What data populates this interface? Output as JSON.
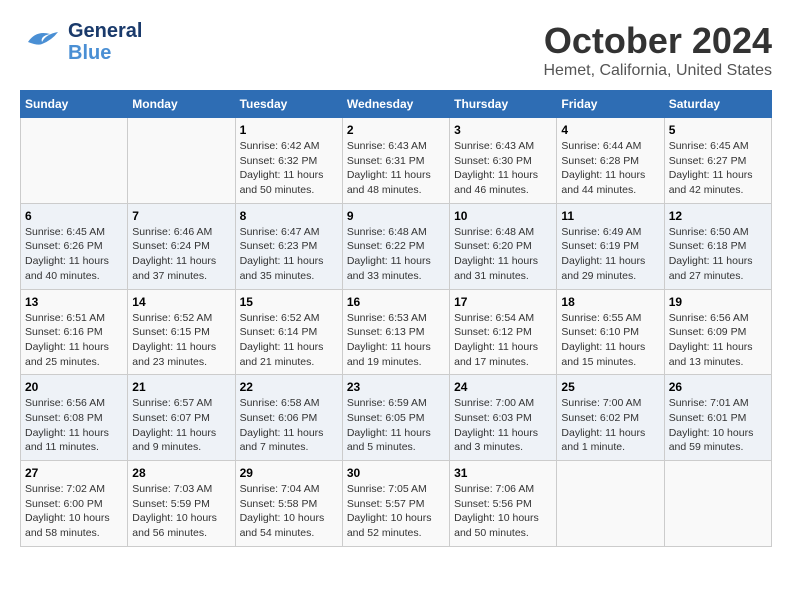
{
  "header": {
    "logo_general": "General",
    "logo_blue": "Blue",
    "month": "October 2024",
    "location": "Hemet, California, United States"
  },
  "days_of_week": [
    "Sunday",
    "Monday",
    "Tuesday",
    "Wednesday",
    "Thursday",
    "Friday",
    "Saturday"
  ],
  "weeks": [
    [
      {
        "day": "",
        "info": ""
      },
      {
        "day": "",
        "info": ""
      },
      {
        "day": "1",
        "info": "Sunrise: 6:42 AM\nSunset: 6:32 PM\nDaylight: 11 hours and 50 minutes."
      },
      {
        "day": "2",
        "info": "Sunrise: 6:43 AM\nSunset: 6:31 PM\nDaylight: 11 hours and 48 minutes."
      },
      {
        "day": "3",
        "info": "Sunrise: 6:43 AM\nSunset: 6:30 PM\nDaylight: 11 hours and 46 minutes."
      },
      {
        "day": "4",
        "info": "Sunrise: 6:44 AM\nSunset: 6:28 PM\nDaylight: 11 hours and 44 minutes."
      },
      {
        "day": "5",
        "info": "Sunrise: 6:45 AM\nSunset: 6:27 PM\nDaylight: 11 hours and 42 minutes."
      }
    ],
    [
      {
        "day": "6",
        "info": "Sunrise: 6:45 AM\nSunset: 6:26 PM\nDaylight: 11 hours and 40 minutes."
      },
      {
        "day": "7",
        "info": "Sunrise: 6:46 AM\nSunset: 6:24 PM\nDaylight: 11 hours and 37 minutes."
      },
      {
        "day": "8",
        "info": "Sunrise: 6:47 AM\nSunset: 6:23 PM\nDaylight: 11 hours and 35 minutes."
      },
      {
        "day": "9",
        "info": "Sunrise: 6:48 AM\nSunset: 6:22 PM\nDaylight: 11 hours and 33 minutes."
      },
      {
        "day": "10",
        "info": "Sunrise: 6:48 AM\nSunset: 6:20 PM\nDaylight: 11 hours and 31 minutes."
      },
      {
        "day": "11",
        "info": "Sunrise: 6:49 AM\nSunset: 6:19 PM\nDaylight: 11 hours and 29 minutes."
      },
      {
        "day": "12",
        "info": "Sunrise: 6:50 AM\nSunset: 6:18 PM\nDaylight: 11 hours and 27 minutes."
      }
    ],
    [
      {
        "day": "13",
        "info": "Sunrise: 6:51 AM\nSunset: 6:16 PM\nDaylight: 11 hours and 25 minutes."
      },
      {
        "day": "14",
        "info": "Sunrise: 6:52 AM\nSunset: 6:15 PM\nDaylight: 11 hours and 23 minutes."
      },
      {
        "day": "15",
        "info": "Sunrise: 6:52 AM\nSunset: 6:14 PM\nDaylight: 11 hours and 21 minutes."
      },
      {
        "day": "16",
        "info": "Sunrise: 6:53 AM\nSunset: 6:13 PM\nDaylight: 11 hours and 19 minutes."
      },
      {
        "day": "17",
        "info": "Sunrise: 6:54 AM\nSunset: 6:12 PM\nDaylight: 11 hours and 17 minutes."
      },
      {
        "day": "18",
        "info": "Sunrise: 6:55 AM\nSunset: 6:10 PM\nDaylight: 11 hours and 15 minutes."
      },
      {
        "day": "19",
        "info": "Sunrise: 6:56 AM\nSunset: 6:09 PM\nDaylight: 11 hours and 13 minutes."
      }
    ],
    [
      {
        "day": "20",
        "info": "Sunrise: 6:56 AM\nSunset: 6:08 PM\nDaylight: 11 hours and 11 minutes."
      },
      {
        "day": "21",
        "info": "Sunrise: 6:57 AM\nSunset: 6:07 PM\nDaylight: 11 hours and 9 minutes."
      },
      {
        "day": "22",
        "info": "Sunrise: 6:58 AM\nSunset: 6:06 PM\nDaylight: 11 hours and 7 minutes."
      },
      {
        "day": "23",
        "info": "Sunrise: 6:59 AM\nSunset: 6:05 PM\nDaylight: 11 hours and 5 minutes."
      },
      {
        "day": "24",
        "info": "Sunrise: 7:00 AM\nSunset: 6:03 PM\nDaylight: 11 hours and 3 minutes."
      },
      {
        "day": "25",
        "info": "Sunrise: 7:00 AM\nSunset: 6:02 PM\nDaylight: 11 hours and 1 minute."
      },
      {
        "day": "26",
        "info": "Sunrise: 7:01 AM\nSunset: 6:01 PM\nDaylight: 10 hours and 59 minutes."
      }
    ],
    [
      {
        "day": "27",
        "info": "Sunrise: 7:02 AM\nSunset: 6:00 PM\nDaylight: 10 hours and 58 minutes."
      },
      {
        "day": "28",
        "info": "Sunrise: 7:03 AM\nSunset: 5:59 PM\nDaylight: 10 hours and 56 minutes."
      },
      {
        "day": "29",
        "info": "Sunrise: 7:04 AM\nSunset: 5:58 PM\nDaylight: 10 hours and 54 minutes."
      },
      {
        "day": "30",
        "info": "Sunrise: 7:05 AM\nSunset: 5:57 PM\nDaylight: 10 hours and 52 minutes."
      },
      {
        "day": "31",
        "info": "Sunrise: 7:06 AM\nSunset: 5:56 PM\nDaylight: 10 hours and 50 minutes."
      },
      {
        "day": "",
        "info": ""
      },
      {
        "day": "",
        "info": ""
      }
    ]
  ]
}
